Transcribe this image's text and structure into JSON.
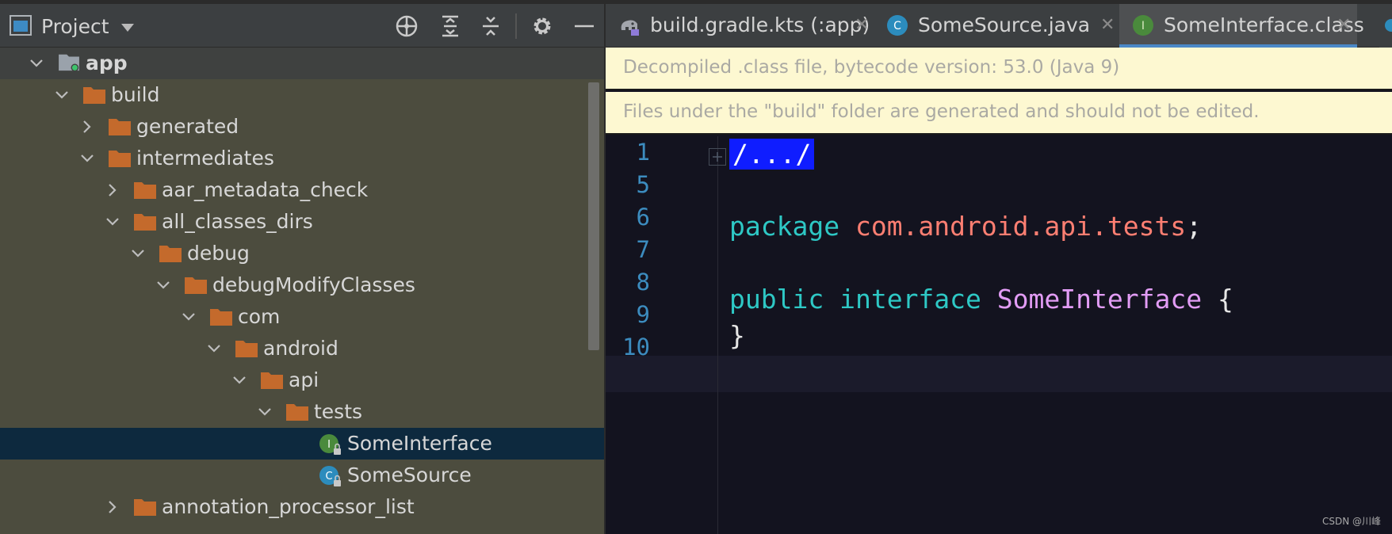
{
  "project_panel": {
    "title": "Project",
    "root": {
      "label": "app"
    },
    "tree": [
      {
        "label": "build",
        "expanded": true
      },
      {
        "label": "generated",
        "expanded": false
      },
      {
        "label": "intermediates",
        "expanded": true
      },
      {
        "label": "aar_metadata_check",
        "expanded": false
      },
      {
        "label": "all_classes_dirs",
        "expanded": true
      },
      {
        "label": "debug",
        "expanded": true
      },
      {
        "label": "debugModifyClasses",
        "expanded": true
      },
      {
        "label": "com",
        "expanded": true
      },
      {
        "label": "android",
        "expanded": true
      },
      {
        "label": "api",
        "expanded": true
      },
      {
        "label": "tests",
        "expanded": true
      },
      {
        "label": "SomeInterface",
        "kind": "interface",
        "icon_letter": "I",
        "selected": true
      },
      {
        "label": "SomeSource",
        "kind": "class",
        "icon_letter": "C"
      },
      {
        "label": "annotation_processor_list",
        "expanded": false
      }
    ]
  },
  "tabs": [
    {
      "label": "build.gradle.kts (:app)",
      "icon": "gradle-elephant-icon"
    },
    {
      "label": "SomeSource.java",
      "icon": "class-icon",
      "icon_letter": "C"
    },
    {
      "label": "SomeInterface.class",
      "icon": "interface-icon",
      "icon_letter": "I",
      "active": true
    }
  ],
  "banners": {
    "decompiled": "Decompiled .class file, bytecode version: 53.0 (Java 9)",
    "build_folder": "Files under the \"build\" folder are generated and should not be edited."
  },
  "editor": {
    "line_numbers": [
      "1",
      "5",
      "6",
      "7",
      "8",
      "9",
      "10"
    ],
    "code": {
      "folded": "/.../",
      "package_kw": "package",
      "package_name": "com.android.api.tests",
      "semicolon": ";",
      "public_kw": "public",
      "interface_kw": "interface",
      "type_name": "SomeInterface",
      "open_brace": "{",
      "close_brace": "}"
    }
  },
  "watermark": "CSDN @川峰",
  "colors": {
    "tree_bg": "#4c4c3e",
    "selected_row": "#0d293e",
    "folder": "#c46a2c",
    "interface_icon": "#4a8a3c",
    "class_icon": "#2c8cbd",
    "banner_bg": "#fdf8d1",
    "keyword": "#2ec8c5",
    "package": "#ff7f72",
    "type_name": "#e29cf5",
    "line_number": "#3c8cbf"
  }
}
